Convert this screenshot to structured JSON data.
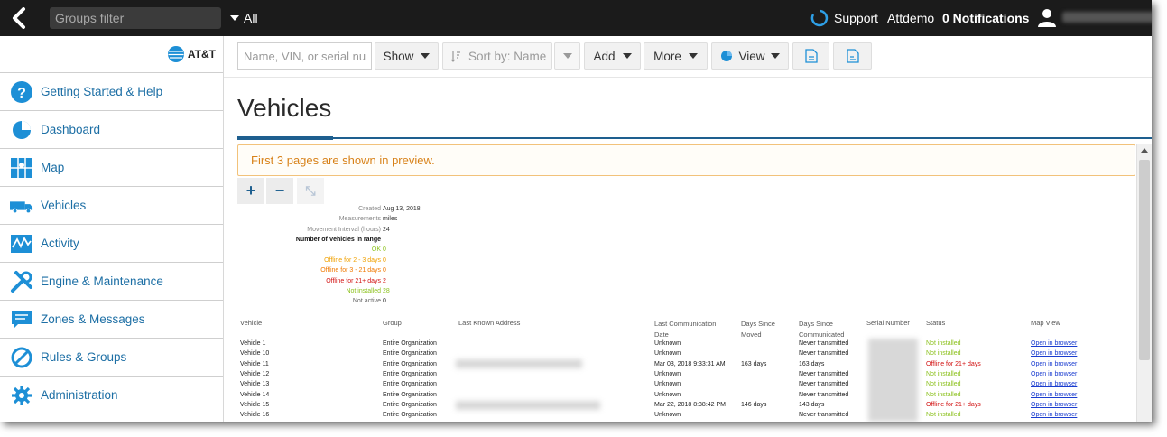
{
  "topbar": {
    "groups_filter_placeholder": "Groups filter",
    "all_label": "All",
    "support_label": "Support",
    "user_name": "Attdemo",
    "notifications_label": "0 Notifications"
  },
  "brand": {
    "name": "AT&T"
  },
  "sidebar": {
    "items": [
      {
        "label": "Getting Started & Help",
        "icon": "help-icon"
      },
      {
        "label": "Dashboard",
        "icon": "dashboard-icon"
      },
      {
        "label": "Map",
        "icon": "map-icon"
      },
      {
        "label": "Vehicles",
        "icon": "truck-icon"
      },
      {
        "label": "Activity",
        "icon": "activity-icon"
      },
      {
        "label": "Engine & Maintenance",
        "icon": "wrench-icon"
      },
      {
        "label": "Zones & Messages",
        "icon": "message-icon"
      },
      {
        "label": "Rules & Groups",
        "icon": "rules-icon"
      },
      {
        "label": "Administration",
        "icon": "gear-icon"
      }
    ]
  },
  "toolbar": {
    "search_placeholder": "Name, VIN, or serial nu",
    "show_label": "Show",
    "sort_label": "Sort by: Name",
    "add_label": "Add",
    "more_label": "More",
    "view_label": "View"
  },
  "page": {
    "title": "Vehicles",
    "notice": "First 3 pages are shown in preview."
  },
  "report": {
    "lines": [
      {
        "label": "Created",
        "value": "Aug 13, 2018"
      },
      {
        "label": "Measurements",
        "value": "miles"
      },
      {
        "label": "Movement Interval (hours)",
        "value": "24"
      },
      {
        "label": "Number of Vehicles in range",
        "value": ""
      },
      {
        "label": "OK",
        "value": "0"
      },
      {
        "label": "Offline for 2 - 3 days",
        "value": "0"
      },
      {
        "label": "Offline for 3 - 21 days",
        "value": "0"
      },
      {
        "label": "Offline for 21+ days",
        "value": "2"
      },
      {
        "label": "Not installed",
        "value": "28"
      },
      {
        "label": "Not active",
        "value": "0"
      }
    ]
  },
  "table": {
    "headers": [
      "Vehicle",
      "Group",
      "Last Known Address",
      "Last Communication\nDate",
      "Days Since\nMoved",
      "Days Since\nCommunicated",
      "Serial Number",
      "Status",
      "Map View"
    ],
    "rows": [
      {
        "vehicle": "Vehicle 1",
        "group": "Entire Organization",
        "date": "Unknown",
        "moved": "",
        "communicated": "Never transmitted",
        "status": "Not installed",
        "map": "Open in browser"
      },
      {
        "vehicle": "Vehicle 10",
        "group": "Entire Organization",
        "date": "Unknown",
        "moved": "",
        "communicated": "Never transmitted",
        "status": "Not installed",
        "map": "Open in browser"
      },
      {
        "vehicle": "Vehicle 11",
        "group": "Entire Organization",
        "date": "Mar 03, 2018 9:33:31 AM",
        "moved": "163 days",
        "communicated": "163 days",
        "status": "Offline for 21+ days",
        "map": "Open in browser"
      },
      {
        "vehicle": "Vehicle 12",
        "group": "Entire Organization",
        "date": "Unknown",
        "moved": "",
        "communicated": "Never transmitted",
        "status": "Not installed",
        "map": "Open in browser"
      },
      {
        "vehicle": "Vehicle 13",
        "group": "Entire Organization",
        "date": "Unknown",
        "moved": "",
        "communicated": "Never transmitted",
        "status": "Not installed",
        "map": "Open in browser"
      },
      {
        "vehicle": "Vehicle 14",
        "group": "Entire Organization",
        "date": "Unknown",
        "moved": "",
        "communicated": "Never transmitted",
        "status": "Not installed",
        "map": "Open in browser"
      },
      {
        "vehicle": "Vehicle 15",
        "group": "Entire Organization",
        "date": "Mar 22, 2018 8:38:42 PM",
        "moved": "146 days",
        "communicated": "143 days",
        "status": "Offline for 21+ days",
        "map": "Open in browser"
      },
      {
        "vehicle": "Vehicle 16",
        "group": "Entire Organization",
        "date": "Unknown",
        "moved": "",
        "communicated": "Never transmitted",
        "status": "Not installed",
        "map": "Open in browser"
      }
    ]
  },
  "colors": {
    "nav_blue": "#1d6fa5",
    "title_rule": "#1e5f8f",
    "notice_text": "#d8821a",
    "ok_green": "#8ac01a",
    "offline_red": "#d21212",
    "offline_orange": "#f0a000"
  }
}
